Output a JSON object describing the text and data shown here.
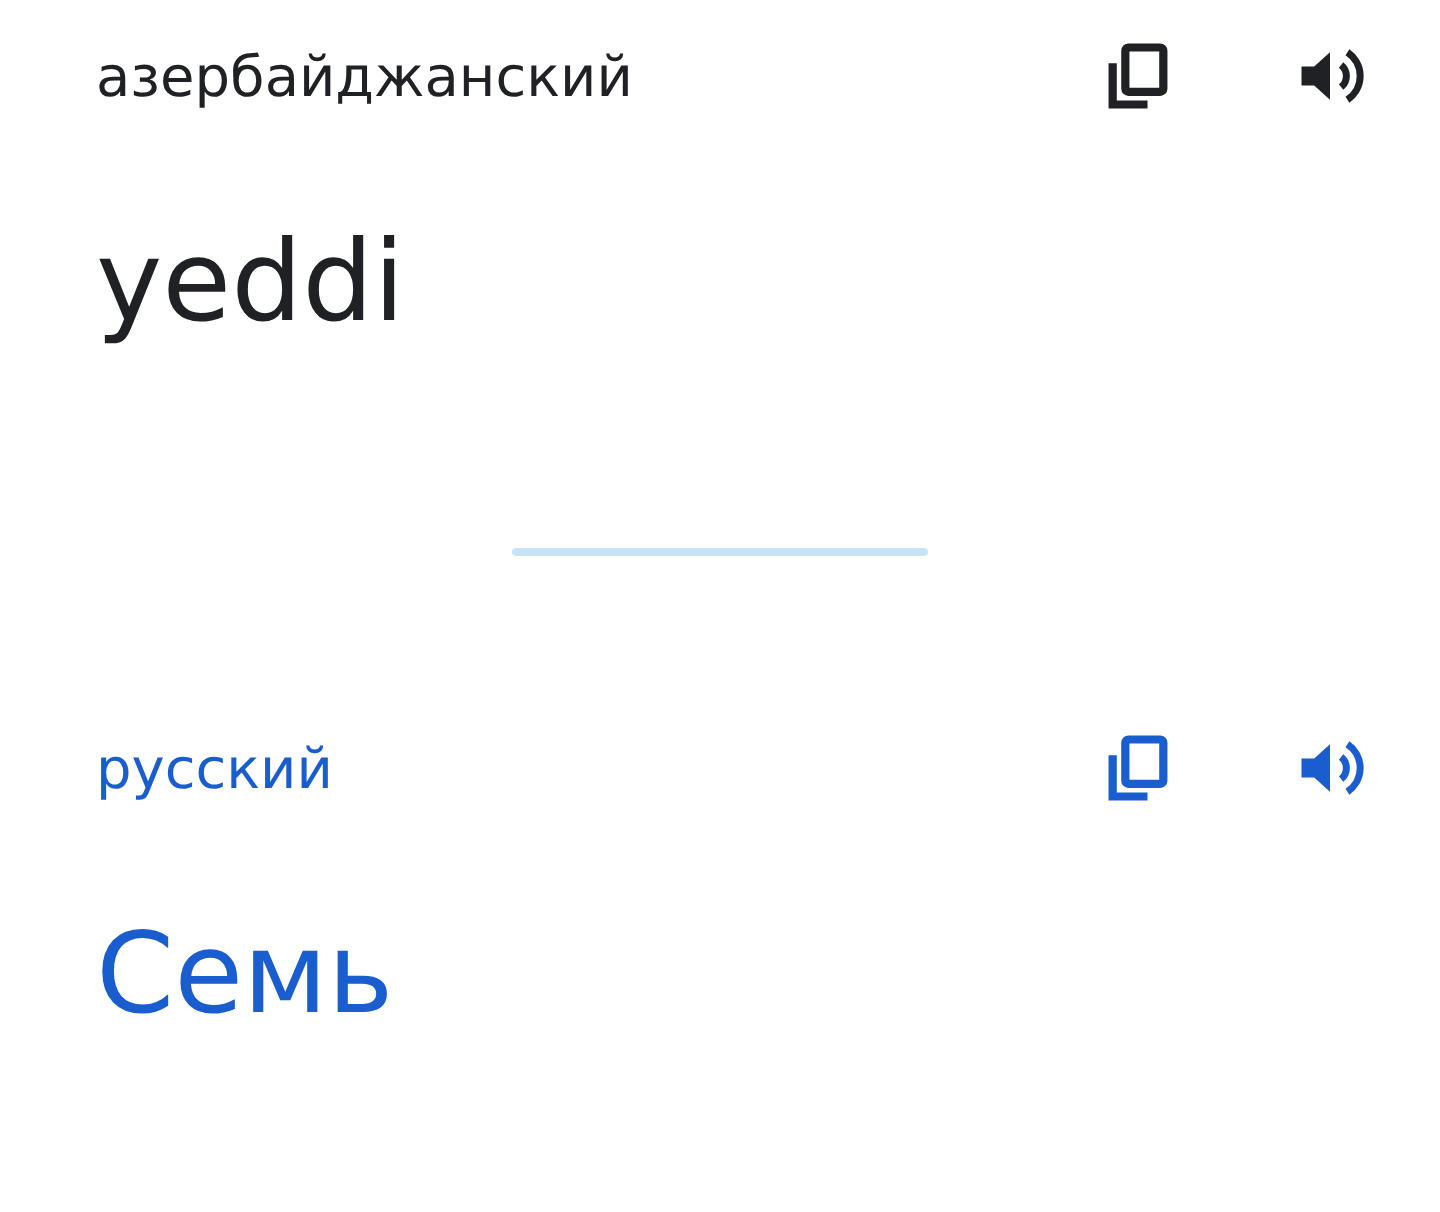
{
  "panels": [
    {
      "kind": "source",
      "language": "азербайджанский",
      "text": "yeddi"
    },
    {
      "kind": "translation",
      "language": "русский",
      "text": "Семь"
    }
  ]
}
